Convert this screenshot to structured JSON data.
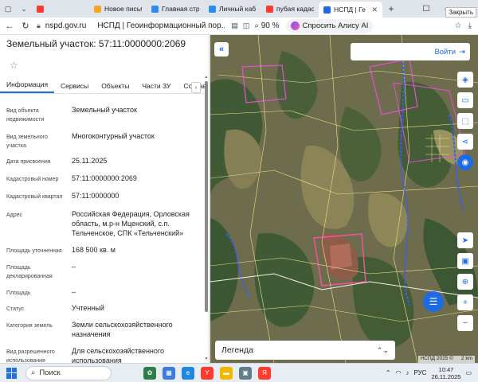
{
  "browser": {
    "tabs": [
      {
        "label": "",
        "color": "#ff3b30"
      },
      {
        "label": "Новое письм",
        "color": "#f5a623"
      },
      {
        "label": "Главная стр",
        "color": "#2d8cf0"
      },
      {
        "label": "Личный каб",
        "color": "#2d8cf0"
      },
      {
        "label": "пубая кадаст",
        "color": "#ff3b30"
      },
      {
        "label": "НСПД | Ге",
        "color": "#1d6ae5",
        "active": true
      }
    ],
    "tooltip": "Закрыть",
    "url": "nspd.gov.ru",
    "page_title": "НСПД | Геоинформационный пор...",
    "zoom": "90 %",
    "alice": "Спросить Алису AI"
  },
  "panel": {
    "title": "Земельный участок: 57:11:0000000:2069",
    "tabs": [
      "Информация",
      "Сервисы",
      "Объекты",
      "Части ЗУ",
      "Состав"
    ],
    "rows": [
      {
        "key": "Вид объекта недвижимости",
        "value": "Земельный участок"
      },
      {
        "key": "Вид земельного участка",
        "value": "Многоконтурный участок"
      },
      {
        "key": "Дата присвоения",
        "value": "25.11.2025"
      },
      {
        "key": "Кадастровый номер",
        "value": "57:11:0000000:2069"
      },
      {
        "key": "Кадастровый квартал",
        "value": "57:11:0000000"
      },
      {
        "key": "Адрес",
        "value": "Российская Федерация, Орловская область, м.р-н Мценский, с.п. Тельченское, СПК «Тельченский»"
      },
      {
        "key": "Площадь уточненная",
        "value": "168 500 кв. м"
      },
      {
        "key": "Площадь декларированная",
        "value": "–"
      },
      {
        "key": "Площадь",
        "value": "–"
      },
      {
        "key": "Статус",
        "value": "Учтенный"
      },
      {
        "key": "Категория земель",
        "value": "Земли сельскохозяйственного назначения"
      },
      {
        "key": "Вид разрешенного использования",
        "value": "Для сельскохозяйственного использования"
      }
    ]
  },
  "map": {
    "login": "Войти",
    "legend": "Легенда",
    "copyright": "НСПД 2025 ©",
    "scale": "2 km"
  },
  "taskbar": {
    "search": "Поиск",
    "lang": "РУС",
    "time": "10:47",
    "date": "26.11.2025"
  }
}
